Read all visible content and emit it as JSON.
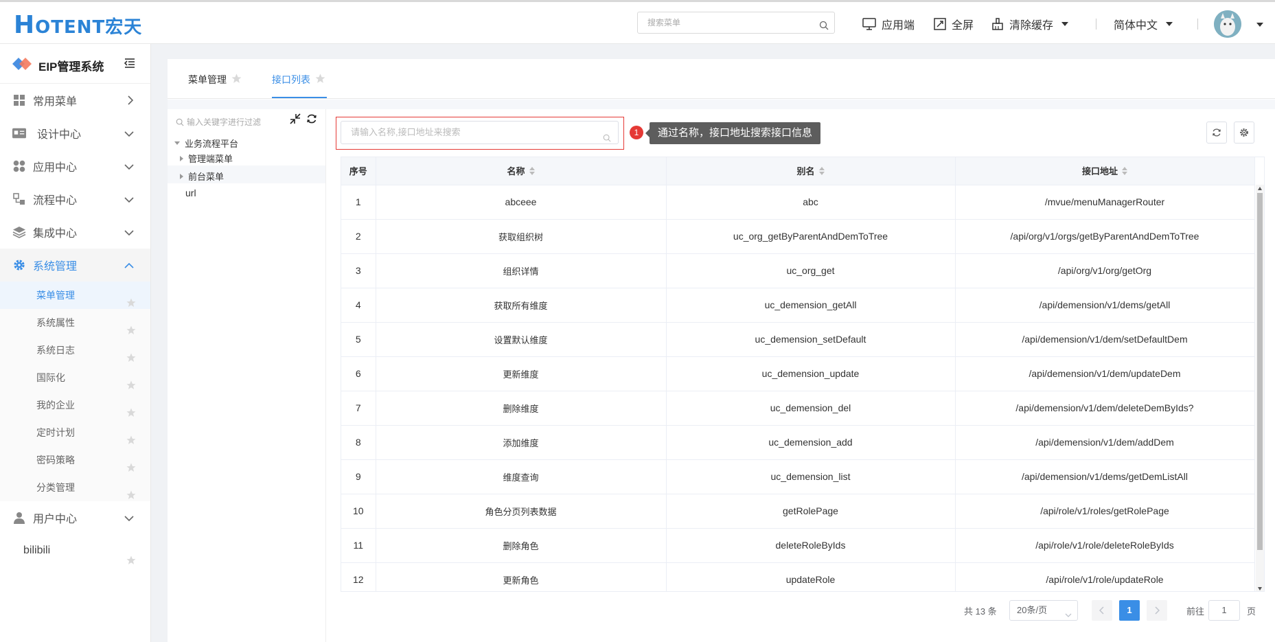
{
  "header": {
    "logo_h": "H",
    "logo_rest": "OTENT宏天",
    "search_placeholder": "搜索菜单",
    "app_end": "应用端",
    "fullscreen": "全屏",
    "clear_cache": "清除缓存",
    "language": "简体中文"
  },
  "sidebar": {
    "title": "EIP管理系统",
    "menus": [
      {
        "label": "常用菜单",
        "icon": "grid-icon"
      },
      {
        "label": "设计中心",
        "icon": "id-card-icon"
      },
      {
        "label": "应用中心",
        "icon": "apps-icon"
      },
      {
        "label": "流程中心",
        "icon": "flow-icon"
      },
      {
        "label": "集成中心",
        "icon": "layers-icon"
      },
      {
        "label": "系统管理",
        "icon": "gear-icon"
      }
    ],
    "submenus": [
      "菜单管理",
      "系统属性",
      "系统日志",
      "国际化",
      "我的企业",
      "定时计划",
      "密码策略",
      "分类管理"
    ],
    "user_center": "用户中心",
    "extra": "bilibili"
  },
  "tabs": [
    "菜单管理",
    "接口列表"
  ],
  "tree": {
    "filter_placeholder": "输入关键字进行过滤",
    "root": "业务流程平台",
    "children": [
      "管理端菜单",
      "前台菜单"
    ],
    "extra": "url"
  },
  "search": {
    "placeholder": "请输入名称,接口地址来搜索",
    "badge": "1",
    "tooltip": "通过名称，接口地址搜索接口信息"
  },
  "table": {
    "headers": [
      "序号",
      "名称",
      "别名",
      "接口地址"
    ],
    "rows": [
      [
        "1",
        "abceee",
        "abc",
        "/mvue/menuManagerRouter"
      ],
      [
        "2",
        "获取组织树",
        "uc_org_getByParentAndDemToTree",
        "/api/org/v1/orgs/getByParentAndDemToTree"
      ],
      [
        "3",
        "组织详情",
        "uc_org_get",
        "/api/org/v1/org/getOrg"
      ],
      [
        "4",
        "获取所有维度",
        "uc_demension_getAll",
        "/api/demension/v1/dems/getAll"
      ],
      [
        "5",
        "设置默认维度",
        "uc_demension_setDefault",
        "/api/demension/v1/dem/setDefaultDem"
      ],
      [
        "6",
        "更新维度",
        "uc_demension_update",
        "/api/demension/v1/dem/updateDem"
      ],
      [
        "7",
        "删除维度",
        "uc_demension_del",
        "/api/demension/v1/dem/deleteDemByIds?"
      ],
      [
        "8",
        "添加维度",
        "uc_demension_add",
        "/api/demension/v1/dem/addDem"
      ],
      [
        "9",
        "维度查询",
        "uc_demension_list",
        "/api/demension/v1/dems/getDemListAll"
      ],
      [
        "10",
        "角色分页列表数据",
        "getRolePage",
        "/api/role/v1/roles/getRolePage"
      ],
      [
        "11",
        "删除角色",
        "deleteRoleByIds",
        "/api/role/v1/role/deleteRoleByIds"
      ],
      [
        "12",
        "更新角色",
        "updateRole",
        "/api/role/v1/role/updateRole"
      ]
    ]
  },
  "pagination": {
    "total": "共 13 条",
    "page_size": "20条/页",
    "current": "1",
    "goto": "前往",
    "goto_value": "1",
    "page_unit": "页"
  },
  "colors": {
    "accent": "#3a8ee6",
    "brand": "#2b83d6",
    "highlight": "#e53935"
  }
}
